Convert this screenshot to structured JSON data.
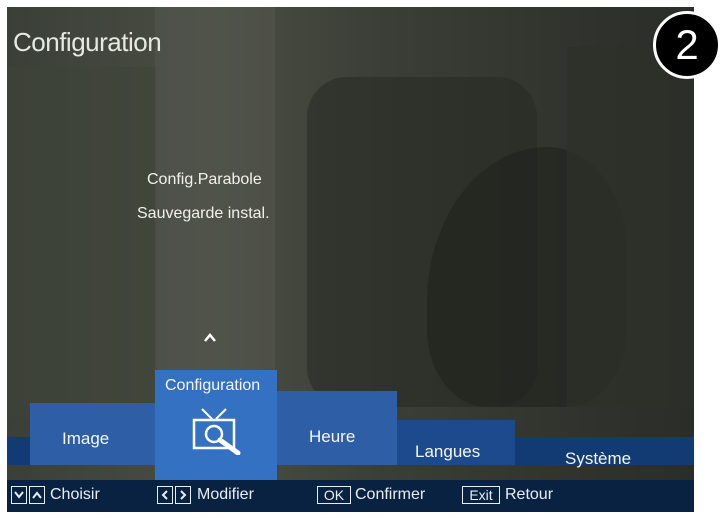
{
  "header": {
    "title": "Configuration",
    "step_badge": "2"
  },
  "submenu": {
    "items": [
      "Config.Parabole",
      "Sauvegarde instal."
    ]
  },
  "tabs": [
    {
      "label": "Image"
    },
    {
      "label": "Configuration",
      "selected": true,
      "icon": "tv-icon"
    },
    {
      "label": "Heure"
    },
    {
      "label": "Langues"
    },
    {
      "label": "Système"
    }
  ],
  "footer": {
    "choose_label": "Choisir",
    "modify_label": "Modifier",
    "ok_key": "OK",
    "confirm_label": "Confirmer",
    "exit_key": "Exit",
    "back_label": "Retour"
  },
  "colors": {
    "tab_bg": "#2d5ea6",
    "tab_selected_bg": "#3471c2",
    "band_bg": "#123a73",
    "footer_bg": "#0a2242"
  }
}
